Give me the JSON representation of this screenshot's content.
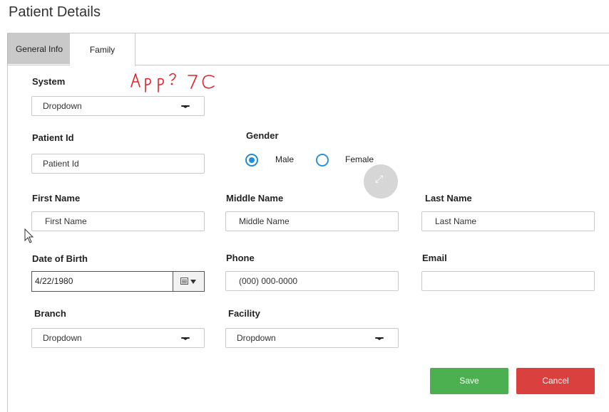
{
  "page": {
    "title": "Patient Details"
  },
  "tabs": [
    {
      "label": "General Info",
      "active": true
    },
    {
      "label": "Family",
      "active": false
    }
  ],
  "annotation": {
    "text": "App? 7C",
    "color": "#e0232b"
  },
  "form": {
    "system": {
      "label": "System",
      "value": "Dropdown"
    },
    "patient_id": {
      "label": "Patient Id",
      "placeholder": "Patient Id"
    },
    "gender": {
      "label": "Gender",
      "options": [
        {
          "label": "Male",
          "selected": true
        },
        {
          "label": "Female",
          "selected": false
        }
      ]
    },
    "first_name": {
      "label": "First Name",
      "placeholder": "First Name"
    },
    "middle_name": {
      "label": "Middle Name",
      "placeholder": "Middle Name"
    },
    "last_name": {
      "label": "Last Name",
      "placeholder": "Last Name"
    },
    "dob": {
      "label": "Date of Birth",
      "value": "4/22/1980"
    },
    "phone": {
      "label": "Phone",
      "placeholder": "(000) 000-0000"
    },
    "email": {
      "label": "Email",
      "value": ""
    },
    "branch": {
      "label": "Branch",
      "value": "Dropdown"
    },
    "facility": {
      "label": "Facility",
      "value": "Dropdown"
    }
  },
  "actions": {
    "save_label": "Save",
    "cancel_label": "Cancel"
  },
  "colors": {
    "accent": "#1f8ed8",
    "save": "#4caf50",
    "cancel": "#d9403e"
  },
  "icons": [
    "expand-icon",
    "calendar-icon",
    "chevron-down-icon",
    "mouse-cursor-icon"
  ]
}
